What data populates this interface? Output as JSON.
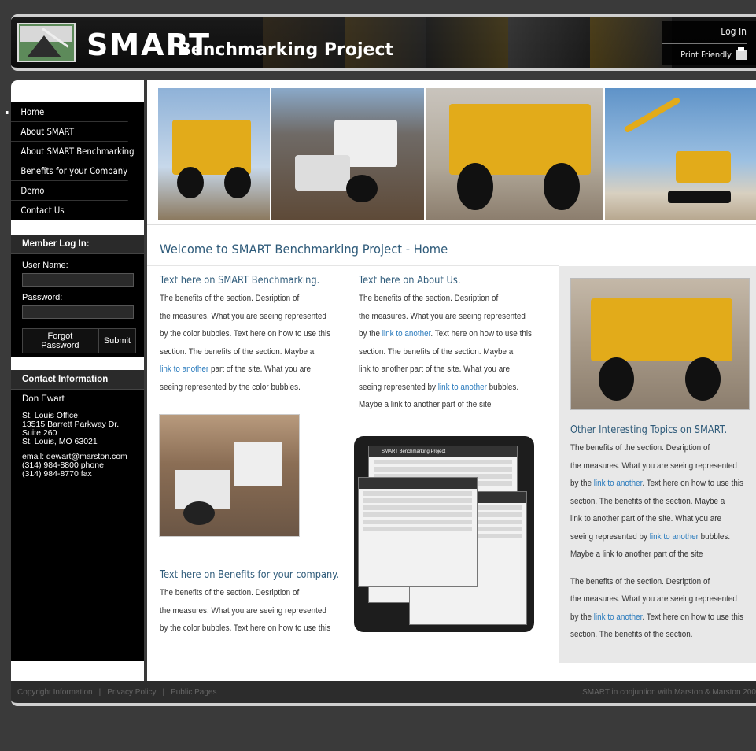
{
  "header": {
    "logo_main": "SMART",
    "logo_sub": "Benchmarking Project",
    "login_link": "Log In",
    "print_link": "Print Friendly"
  },
  "nav": {
    "items": [
      {
        "label": "Home"
      },
      {
        "label": "About SMART"
      },
      {
        "label": "About SMART Benchmarking"
      },
      {
        "label": "Benefits for your Company"
      },
      {
        "label": "Demo"
      },
      {
        "label": "Contact Us"
      }
    ]
  },
  "login": {
    "title": "Member Log In:",
    "username_label": "User Name:",
    "password_label": "Password:",
    "forgot_label": "Forgot Password",
    "submit_label": "Submit"
  },
  "contact": {
    "title": "Contact Information",
    "name": "Don Ewart",
    "office": "St. Louis Office:",
    "street": "13515 Barrett Parkway Dr.",
    "suite": "Suite 260",
    "city": "St. Louis, MO 63021",
    "email": "email: dewart@marston.com",
    "phone": "(314) 984-8800 phone",
    "fax": "(314) 984-8770 fax"
  },
  "main": {
    "title": "Welcome to SMART Benchmarking Project - Home",
    "col1": {
      "heading": "Text here on SMART Benchmarking.",
      "l1": "The benefits of the section. Desription of",
      "l2": "the measures. What you are seeing represented",
      "l3": "by the color bubbles. Text here on how to use this",
      "l4": "section. The benefits of the section. Maybe a",
      "l5_link": "link to another",
      "l5_rest": " part of the site. What you are",
      "l6": "seeing represented by the color bubbles."
    },
    "col2": {
      "heading": "Text here on About Us.",
      "l1": "The benefits of the section. Desription of",
      "l2": "the measures. What you are seeing represented",
      "l3_pre": "by the ",
      "l3_link": "link to another",
      "l3_post": ". Text here on how to use this",
      "l4": "section. The benefits of the section. Maybe a",
      "l5": "link to another part of the site. What you are",
      "l6_pre": "seeing represented by ",
      "l6_link": "link to another",
      "l6_post": " bubbles.",
      "l7": "Maybe a link to another part of the site"
    },
    "col3": {
      "heading": "Text here on Benefits for your company.",
      "l1": "The benefits of the section. Desription of",
      "l2": "the measures. What you are seeing represented",
      "l3": "by the color bubbles. Text here on how to use this"
    },
    "col4": {
      "heading": "Other Interesting Topics on SMART.",
      "l1": "The benefits of the section. Desription of",
      "l2": "the measures. What you are seeing represented",
      "l3_pre": "by the ",
      "l3_link": "link to another",
      "l3_post": ". Text here on how to use this",
      "l4": "section. The benefits of the section. Maybe a",
      "l5": "link to another part of the site. What you are",
      "l6_pre": "seeing represented by ",
      "l6_link": "link to another",
      "l6_post": " bubbles.",
      "l7": "Maybe a link to another part of the site",
      "l8": "The benefits of the section. Desription of",
      "l9": "the measures. What you are seeing represented",
      "l10_pre": "by the ",
      "l10_link": "link to another",
      "l10_post": ". Text here on how to use this",
      "l11": "section. The benefits of the section."
    },
    "screenshot_app_title": "SMART Benchmarking Project"
  },
  "footer": {
    "copyright": "Copyright Information",
    "privacy": "Privacy Policy",
    "public": "Public Pages",
    "sep": "|",
    "right": "SMART in conjuntion with Marston & Marston 200"
  },
  "colors": {
    "accent_blue": "#2f5b7a",
    "link_blue": "#2a7bbd",
    "truck_yellow": "#e2ab1a"
  }
}
